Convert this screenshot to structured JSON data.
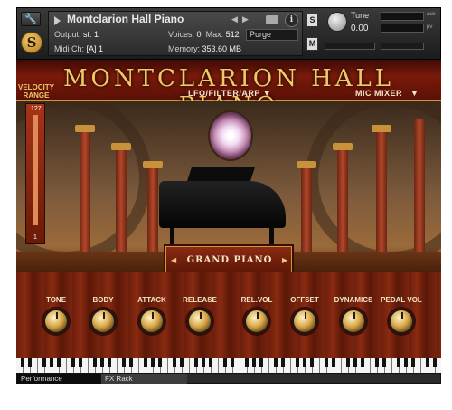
{
  "header": {
    "instrument_title": "Montclarion Hall Piano",
    "output_label": "Output:",
    "output_value": "st. 1",
    "voices_label": "Voices:",
    "voices_value": "0",
    "max_label": "Max:",
    "max_value": "512",
    "purge_label": "Purge",
    "midi_label": "Midi Ch:",
    "midi_value": "[A] 1",
    "memory_label": "Memory:",
    "memory_value": "353.60 MB",
    "tune_label": "Tune",
    "tune_value": "0.00",
    "s_button": "S",
    "m_button": "M",
    "info_button": "i",
    "aux_label": "aux",
    "pv_label": "pv"
  },
  "instrument": {
    "banner_title": "MONTCLARION HALL PIANO",
    "velocity_range_label": "VELOCITY RANGE",
    "velocity_max": "127",
    "velocity_min": "1",
    "lfo_menu": "LFO/FILTER/ARP",
    "mic_mixer_menu": "MIC MIXER",
    "preset_name": "GRAND PIANO",
    "controls": [
      {
        "label": "TONE",
        "value": 0.5
      },
      {
        "label": "BODY",
        "value": 0.5
      },
      {
        "label": "ATTACK",
        "value": 0.5
      },
      {
        "label": "RELEASE",
        "value": 0.5
      },
      {
        "label": "REL.VOL",
        "value": 0.5
      },
      {
        "label": "OFFSET",
        "value": 0.5
      },
      {
        "label": "DYNAMICS",
        "value": 0.5
      },
      {
        "label": "PEDAL VOL",
        "value": 0.5
      }
    ]
  },
  "tabs": [
    "Performance",
    "FX Rack"
  ],
  "colors": {
    "accent_gold": "#f0c866",
    "wood_red": "#8a2a12",
    "header_dark": "#2b2b2b"
  }
}
